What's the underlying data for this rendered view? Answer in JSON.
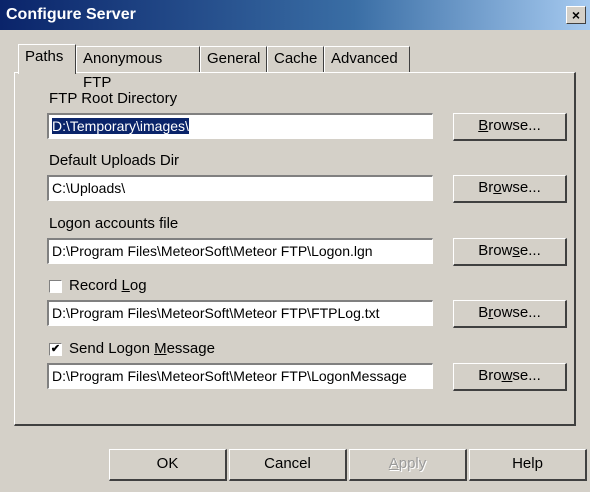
{
  "window": {
    "title": "Configure Server",
    "close_glyph": "×"
  },
  "tabs": [
    "Paths",
    "Anonymous FTP",
    "General",
    "Cache",
    "Advanced"
  ],
  "active_tab": "Paths",
  "paths": {
    "ftp_root": {
      "label": "FTP Root Directory",
      "value": "D:\\Temporary\\images\\",
      "selected": true
    },
    "uploads": {
      "label": "Default Uploads Dir",
      "value": "C:\\Uploads\\"
    },
    "logon": {
      "label": "Logon accounts file",
      "value": "D:\\Program Files\\MeteorSoft\\Meteor FTP\\Logon.lgn"
    },
    "record_log": {
      "label_pre": "Record ",
      "label_u": "L",
      "label_post": "og",
      "checked": false,
      "value": "D:\\Program Files\\MeteorSoft\\Meteor FTP\\FTPLog.txt"
    },
    "logon_message": {
      "label_pre": "Send Logon ",
      "label_u": "M",
      "label_post": "essage",
      "checked": true,
      "value": "D:\\Program Files\\MeteorSoft\\Meteor FTP\\LogonMessage"
    }
  },
  "browse_buttons": [
    {
      "pre": "",
      "u": "B",
      "post": "rowse..."
    },
    {
      "pre": "Br",
      "u": "o",
      "post": "wse..."
    },
    {
      "pre": "Brow",
      "u": "s",
      "post": "e..."
    },
    {
      "pre": "B",
      "u": "r",
      "post": "owse..."
    },
    {
      "pre": "Bro",
      "u": "w",
      "post": "se..."
    }
  ],
  "footer": {
    "ok": "OK",
    "cancel": "Cancel",
    "apply": {
      "pre": "",
      "u": "A",
      "post": "pply",
      "enabled": false
    },
    "help": "Help"
  },
  "icons": {
    "checkbox_checked_glyph": "✔"
  }
}
